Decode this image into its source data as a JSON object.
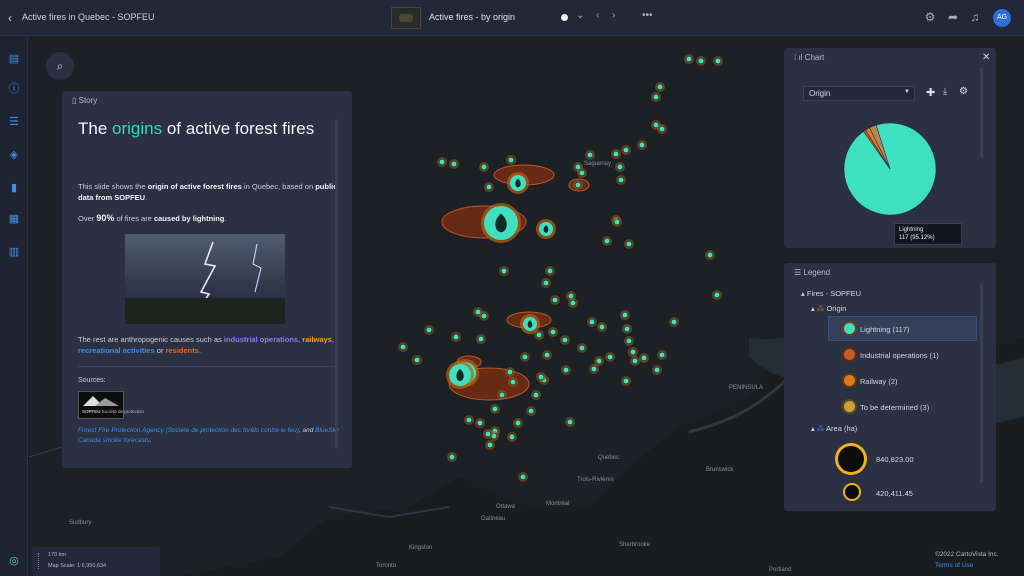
{
  "topbar": {
    "app_title": "Active fires in Quebec - SOPFEU",
    "slide_title": "Active fires - by origin"
  },
  "icons": {
    "back": "chevron-left-icon",
    "search": "search-icon",
    "settings": "gear-icon",
    "share": "share-icon",
    "bell": "bell-icon"
  },
  "user": {
    "initials": "AG"
  },
  "story": {
    "header": "Story",
    "title_part1": "The ",
    "title_accent": "origins",
    "title_part2": " of active forest fires",
    "p1_a": "This slide shows the ",
    "p1_b": "origin of active forest fires",
    "p1_c": " in Quebec, based on ",
    "p1_d": "public data from SOPFEU",
    "p1_e": ".",
    "p2_a": "Over ",
    "p2_b": "90%",
    "p2_c": " of fires are ",
    "p2_d": "caused by lightning",
    "p2_e": ".",
    "p3_a": "The rest are anthropogenic causes such as ",
    "p3_b": "industrial operations",
    "p3_c": ", ",
    "p3_d": "railways",
    "p3_e": ", ",
    "p3_f": "recreational activities",
    "p3_g": " or ",
    "p3_h": "residents",
    "p3_i": ".",
    "sources_label": "Sources:",
    "logo_name": "SOPFEU",
    "logo_sub": "Société de protection",
    "src_a": "Forest Fire Protection Agency (Societe de protection des forêts contre le feu)",
    "src_b": ", and ",
    "src_c": "BlueSky Canada smoke forecasts",
    "src_d": "."
  },
  "chart_panel": {
    "header": "Chart",
    "select_value": "Origin",
    "tooltip_line1": "Lightning",
    "tooltip_line2": "117 (95.12%)"
  },
  "chart_data": {
    "type": "pie",
    "categories": [
      "Lightning",
      "Industrial operations",
      "Railway",
      "To be determined"
    ],
    "values": [
      117,
      1,
      2,
      3
    ],
    "colors": [
      "#3fe0c0",
      "#c65a2a",
      "#e07a1a",
      "#b48a5a"
    ]
  },
  "legend": {
    "header": "Legend",
    "layer": "Fires - SOPFEU",
    "group1": "Origin",
    "items": [
      {
        "label": "Lightning (117)",
        "color": "#3fe0c0"
      },
      {
        "label": "Industrial operations (1)",
        "color": "#c65a2a"
      },
      {
        "label": "Railway (2)",
        "color": "#e07a1a"
      },
      {
        "label": "To be determined (3)",
        "color": "#c8a040"
      }
    ],
    "group2": "Area (ha)",
    "sizes": [
      "840,823.00",
      "420,411.45"
    ]
  },
  "map": {
    "labels": [
      "Québec",
      "Ottawa",
      "Montréal",
      "Toronto",
      "Sherbrooke",
      "Gatineau",
      "Trois-Rivières",
      "Saguenay",
      "Sudbury",
      "Kingston",
      "Brunswick",
      "PENINSULA",
      "Portland"
    ]
  },
  "scale": {
    "distance": "170 km",
    "map_scale": "Map Scale: 1:6,950,634"
  },
  "footer": {
    "copyright": "©2022 CartoVista Inc.",
    "terms": "Terms of Use"
  }
}
